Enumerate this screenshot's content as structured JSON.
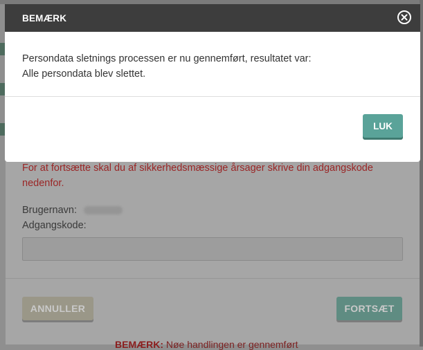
{
  "dialog": {
    "title": "BEMÆRK",
    "close_icon": "close-circle-icon",
    "message_line1": "Persondata sletnings processen er nu gennemført, resultatet var:",
    "message_line2": "Alle persondata blev slettet.",
    "close_button_label": "LUK"
  },
  "background": {
    "warning_text": "For at fortsætte skal du af sikkerhedsmæssige årsager skrive din adgangskode nedenfor.",
    "username_label": "Brugernavn:",
    "password_label": "Adgangskode:",
    "cancel_label": "ANNULLER",
    "continue_label": "FORTSÆT",
    "footer_note_bold": "BEMÆRK:",
    "footer_note_text": " Nøe handlingen er gennemført"
  },
  "colors": {
    "header_bg": "#3d3d3d",
    "accent": "#5aa399",
    "overlay": "#8f8f8f",
    "warning": "#9a2626"
  }
}
